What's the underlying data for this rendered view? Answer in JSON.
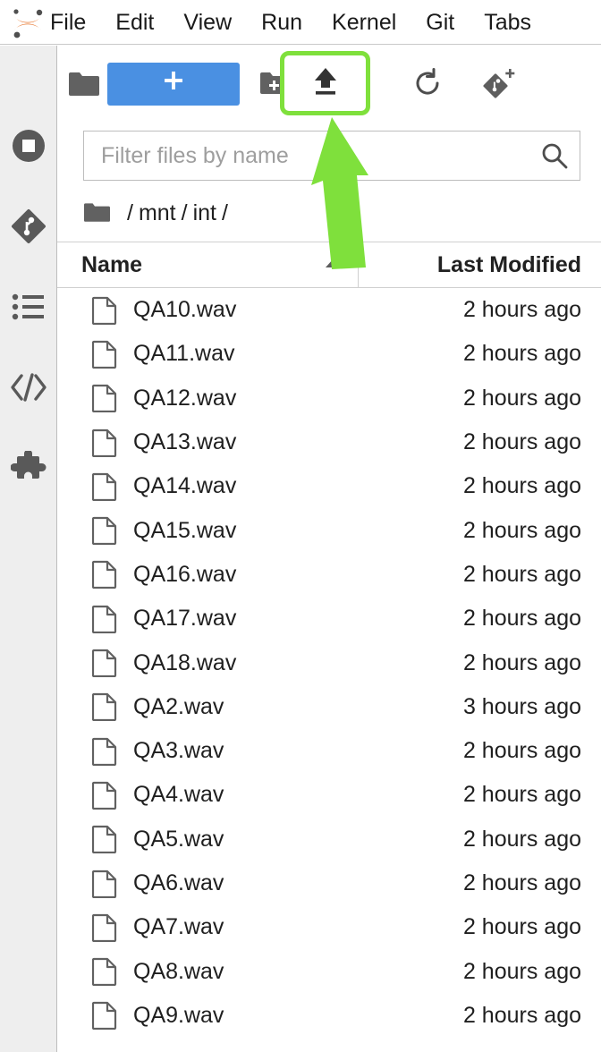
{
  "app": {
    "logo_icon": "jupyter-logo",
    "accent_blue": "#4a90e2",
    "highlight_green": "#7fe03c",
    "icon_gray": "#616161"
  },
  "menubar": {
    "items": [
      {
        "label": "File"
      },
      {
        "label": "Edit"
      },
      {
        "label": "View"
      },
      {
        "label": "Run"
      },
      {
        "label": "Kernel"
      },
      {
        "label": "Git"
      },
      {
        "label": "Tabs"
      }
    ]
  },
  "sidebar": {
    "items": [
      {
        "name": "running-terminals-and-kernels",
        "icon": "stop-circle-icon"
      },
      {
        "name": "git",
        "icon": "git-diamond-icon"
      },
      {
        "name": "table-of-contents",
        "icon": "list-icon"
      },
      {
        "name": "debugger",
        "icon": "code-brackets-icon"
      },
      {
        "name": "extension-manager",
        "icon": "puzzle-piece-icon"
      }
    ]
  },
  "toolbar": {
    "folder_icon": "folder-icon",
    "new_launcher_label": "+",
    "buttons": [
      {
        "name": "new-folder",
        "icon": "folder-plus-icon",
        "highlighted": false
      },
      {
        "name": "upload-files",
        "icon": "upload-icon",
        "highlighted": true
      },
      {
        "name": "refresh-file-list",
        "icon": "refresh-icon",
        "highlighted": false
      },
      {
        "name": "git-clone",
        "icon": "git-clone-icon",
        "highlighted": false
      }
    ]
  },
  "filter": {
    "placeholder": "Filter files by name",
    "value": "",
    "icon": "search-icon"
  },
  "breadcrumb": {
    "root_icon": "folder-icon",
    "parts": [
      "mnt",
      "int"
    ],
    "separator": "/"
  },
  "table": {
    "columns": {
      "name": "Name",
      "last_modified": "Last Modified"
    },
    "sort": {
      "column": "Name",
      "direction": "ascending",
      "icon": "triangle-up-icon"
    },
    "rows": [
      {
        "name": "QA10.wav",
        "last_modified": "2 hours ago",
        "icon": "file-icon"
      },
      {
        "name": "QA11.wav",
        "last_modified": "2 hours ago",
        "icon": "file-icon"
      },
      {
        "name": "QA12.wav",
        "last_modified": "2 hours ago",
        "icon": "file-icon"
      },
      {
        "name": "QA13.wav",
        "last_modified": "2 hours ago",
        "icon": "file-icon"
      },
      {
        "name": "QA14.wav",
        "last_modified": "2 hours ago",
        "icon": "file-icon"
      },
      {
        "name": "QA15.wav",
        "last_modified": "2 hours ago",
        "icon": "file-icon"
      },
      {
        "name": "QA16.wav",
        "last_modified": "2 hours ago",
        "icon": "file-icon"
      },
      {
        "name": "QA17.wav",
        "last_modified": "2 hours ago",
        "icon": "file-icon"
      },
      {
        "name": "QA18.wav",
        "last_modified": "2 hours ago",
        "icon": "file-icon"
      },
      {
        "name": "QA2.wav",
        "last_modified": "3 hours ago",
        "icon": "file-icon"
      },
      {
        "name": "QA3.wav",
        "last_modified": "2 hours ago",
        "icon": "file-icon"
      },
      {
        "name": "QA4.wav",
        "last_modified": "2 hours ago",
        "icon": "file-icon"
      },
      {
        "name": "QA5.wav",
        "last_modified": "2 hours ago",
        "icon": "file-icon"
      },
      {
        "name": "QA6.wav",
        "last_modified": "2 hours ago",
        "icon": "file-icon"
      },
      {
        "name": "QA7.wav",
        "last_modified": "2 hours ago",
        "icon": "file-icon"
      },
      {
        "name": "QA8.wav",
        "last_modified": "2 hours ago",
        "icon": "file-icon"
      },
      {
        "name": "QA9.wav",
        "last_modified": "2 hours ago",
        "icon": "file-icon"
      }
    ]
  },
  "annotation": {
    "arrow_color": "#7fe03c",
    "target": "upload-files-button"
  }
}
